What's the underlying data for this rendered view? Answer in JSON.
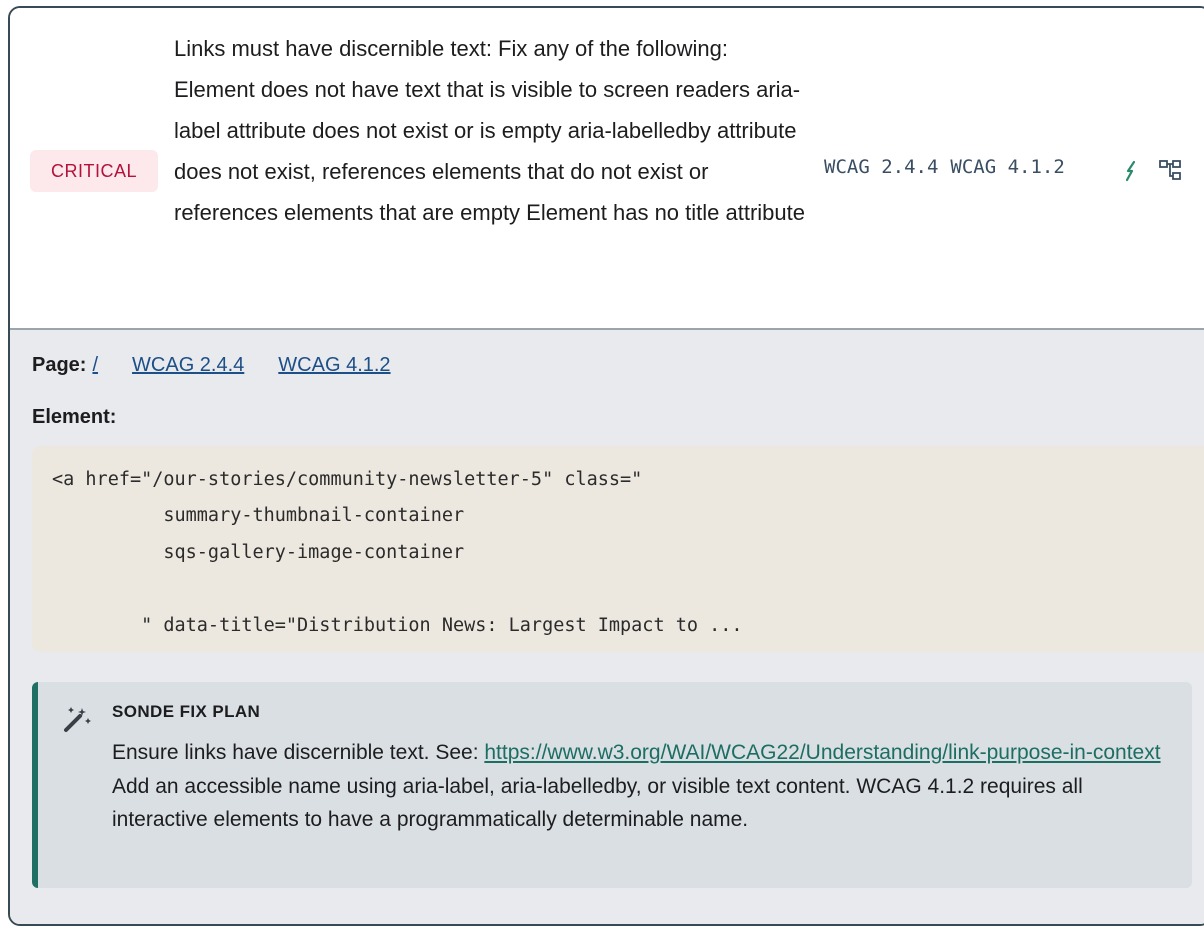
{
  "issue": {
    "severity": "CRITICAL",
    "description": "Links must have discernible text: Fix any of the following: Element does not have text that is visible to screen readers aria-label attribute does not exist or is empty aria-labelledby attribute does not exist, references elements that do not exist or references elements that are empty Element has no title attribute",
    "wcag_tags": [
      "WCAG 2.4.4",
      "WCAG 4.1.2"
    ],
    "icons": {
      "quick_fix": "lightning-icon",
      "element_tree": "element-tree-icon"
    }
  },
  "details": {
    "page_label": "Page:",
    "page_link": "/",
    "wcag_links": [
      "WCAG 2.4.4",
      "WCAG 4.1.2"
    ],
    "element_label": "Element:",
    "element_code": "<a href=\"/our-stories/community-newsletter-5\" class=\"\n          summary-thumbnail-container\n          sqs-gallery-image-container\n\n        \" data-title=\"Distribution News: Largest Impact to ..."
  },
  "fix_plan": {
    "icon": "magic-wand-icon",
    "title": "SONDE FIX PLAN",
    "text_before": "Ensure links have discernible text. See: ",
    "link": "https://www.w3.org/WAI/WCAG22/Understanding/link-purpose-in-context",
    "text_after": " Add an accessible name using aria-label, aria-labelledby, or visible text content. WCAG 4.1.2 requires all interactive elements to have a programmatically determinable name."
  },
  "colors": {
    "severity_bg": "#fde8eb",
    "severity_text": "#b3123a",
    "link": "#1d4f88",
    "fix_accent": "#1f6f65"
  }
}
